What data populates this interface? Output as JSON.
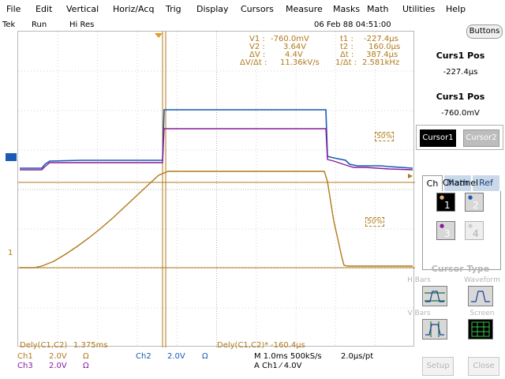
{
  "menu": [
    "File",
    "Edit",
    "Vertical",
    "Horiz/Acq",
    "Trig",
    "Display",
    "Cursors",
    "Measure",
    "Masks",
    "Math",
    "Utilities",
    "Help"
  ],
  "status": {
    "brand": "Tek",
    "run": "Run",
    "mode": "Hi Res",
    "datetime": "06 Feb 88 04:51:00"
  },
  "cursor_readouts": {
    "v1_label": "V1 :",
    "v1": "-760.0mV",
    "v2_label": "V2 :",
    "v2": "3.64V",
    "dv_label": "ΔV :",
    "dv": "4.4V",
    "dvdt_label": "ΔV/Δt :",
    "dvdt": "11.36kV/s",
    "t1_label": "t1 :",
    "t1": "-227.4µs",
    "t2_label": "t2 :",
    "t2": "160.0µs",
    "dt_label": "Δt :",
    "dt": "387.4µs",
    "inv_label": "1/Δt :",
    "inv": "2.581kHz"
  },
  "markers": {
    "ch_left_1": "1",
    "ref_50a": "50%",
    "ref_50b": "50%"
  },
  "delays": {
    "dely1_label": "Dely(C1,C2)",
    "dely1": "1.375ms",
    "dely2_label": "Dely(C1,C2)*",
    "dely2": "-160.4µs"
  },
  "bottom": {
    "ch1": "Ch1",
    "ch1_scale": "2.0V",
    "ch1_unit": "Ω",
    "ch2": "Ch2",
    "ch2_scale": "2.0V",
    "ch2_unit": "Ω",
    "ch3": "Ch3",
    "ch3_scale": "2.0V",
    "ch3_unit": "Ω",
    "timebase": "M 1.0ms 500kS/s",
    "sampling": "2.0µs/pt",
    "trigger": "A  Ch1  ⁄  4.0V"
  },
  "sidepanel": {
    "buttons": "Buttons",
    "curs1_pos_label": "Curs1 Pos",
    "curs1_pos_time": "-227.4µs",
    "curs1_pos_label2": "Curs1 Pos",
    "curs1_pos_volt": "-760.0mV",
    "cursor1": "Cursor1",
    "cursor2": "Cursor2",
    "tabs": [
      "Ch",
      "Math",
      "Ref"
    ],
    "channel_label": "Channel",
    "channels": [
      "1",
      "2",
      "3",
      "4"
    ],
    "cursor_type_label": "Cursor Type",
    "h_bars": "H Bars",
    "waveform": "Waveform",
    "v_bars": "V Bars",
    "screen": "Screen",
    "setup": "Setup",
    "close": "Close"
  },
  "colors": {
    "ch1": "#b0791a",
    "ch2": "#1a5bb5",
    "ch3": "#8a1a9b",
    "grid": "#b9b9b9"
  }
}
